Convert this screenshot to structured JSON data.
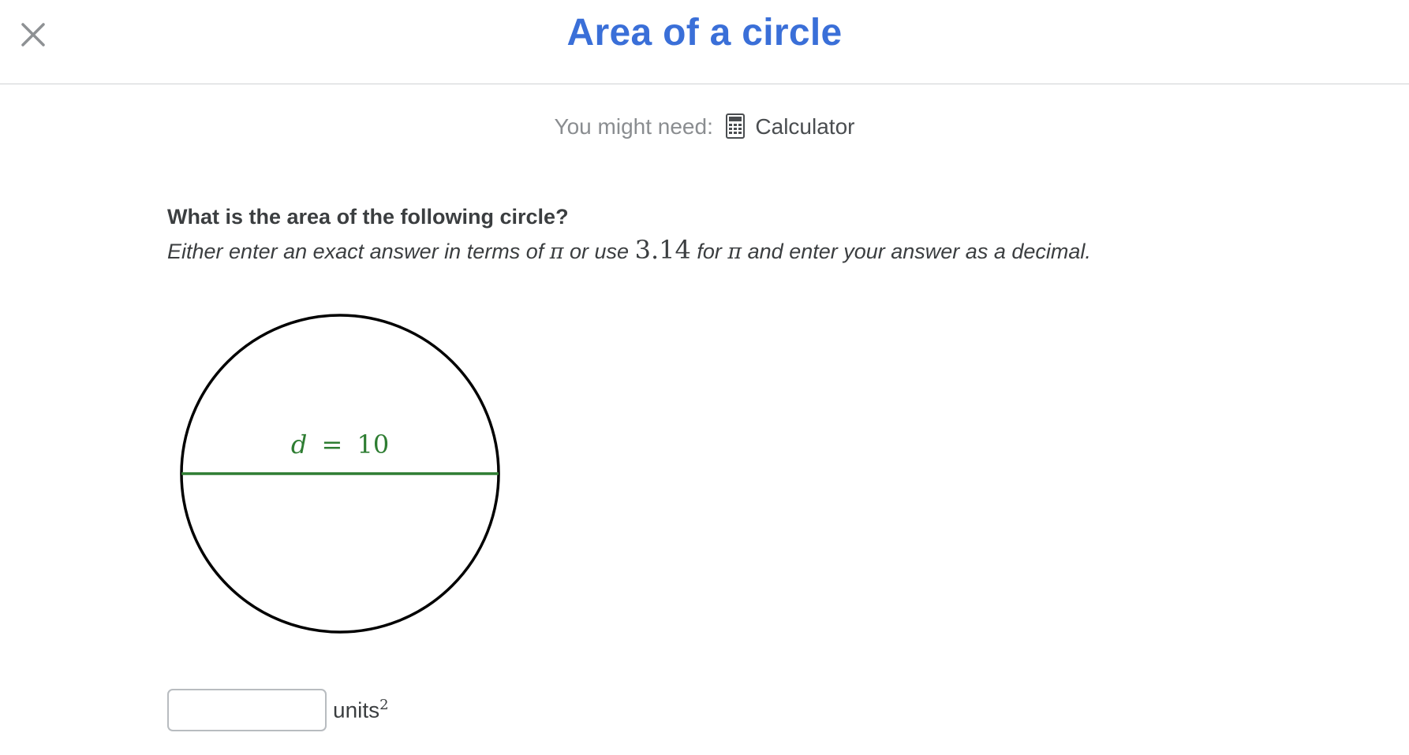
{
  "header": {
    "title": "Area of a circle",
    "close_icon": "close-icon"
  },
  "tools": {
    "label": "You might need:",
    "calculator_icon": "calculator-icon",
    "calculator_label": "Calculator"
  },
  "problem": {
    "question": "What is the area of the following circle?",
    "instructions": {
      "part1": "Either enter an exact answer in terms of",
      "pi": "π",
      "part2": "or use",
      "approx": "3.14",
      "part3": "for",
      "part4": "and enter your answer as a decimal."
    }
  },
  "figure": {
    "diameter_var": "d",
    "equals": "=",
    "diameter_value": "10",
    "diameter_color": "#2e7d32"
  },
  "answer": {
    "value": "",
    "units": "units",
    "exponent": "2"
  },
  "colors": {
    "title": "#3a6fd8",
    "text": "#3b3e40",
    "muted": "#8a8d90"
  }
}
